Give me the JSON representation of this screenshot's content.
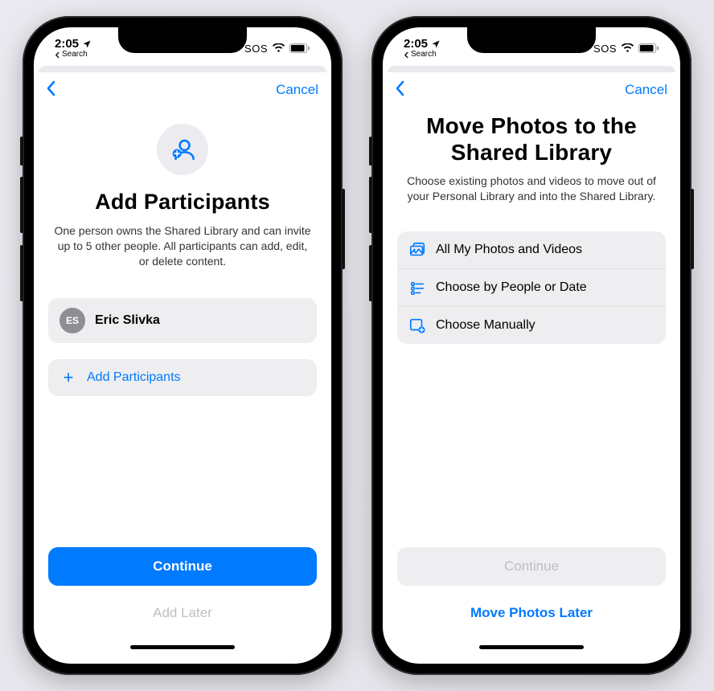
{
  "status": {
    "time": "2:05",
    "back_search": "Search",
    "sos": "SOS"
  },
  "nav": {
    "cancel": "Cancel"
  },
  "left": {
    "title": "Add Participants",
    "subtitle": "One person owns the Shared Library and can invite up to 5 other people. All participants can add, edit, or delete content.",
    "participant": {
      "initials": "ES",
      "name": "Eric Slivka"
    },
    "add_row_label": "Add Participants",
    "primary_button": "Continue",
    "secondary_button": "Add Later"
  },
  "right": {
    "title": "Move Photos to the Shared Library",
    "subtitle": "Choose existing photos and videos to move out of your Personal Library and into the Shared Library.",
    "options": [
      {
        "label": "All My Photos and Videos"
      },
      {
        "label": "Choose by People or Date"
      },
      {
        "label": "Choose Manually"
      }
    ],
    "primary_button": "Continue",
    "secondary_button": "Move Photos Later"
  }
}
